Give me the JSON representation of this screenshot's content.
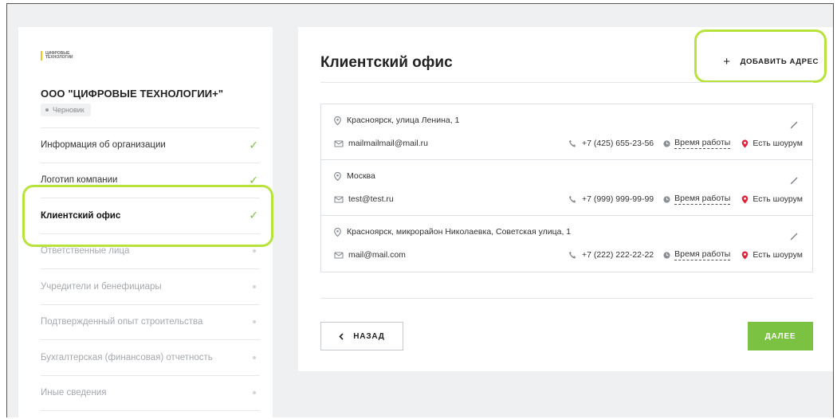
{
  "colors": {
    "accent": "#7cc242",
    "highlight": "#b8e23c",
    "pin_red": "#e0213a"
  },
  "sidebar": {
    "logo_text": "ЦИФРОВЫЕ ТЕХНОЛОГИИ",
    "org_name": "ООО \"ЦИФРОВЫЕ ТЕХНОЛОГИИ+\"",
    "status": "Черновик",
    "items": [
      {
        "label": "Информация об организации",
        "state": "done"
      },
      {
        "label": "Логотип компании",
        "state": "done"
      },
      {
        "label": "Клиентский офис",
        "state": "active"
      },
      {
        "label": "Ответственные лица",
        "state": "pending"
      },
      {
        "label": "Учредители и бенефициары",
        "state": "pending"
      },
      {
        "label": "Подтвержденный опыт строительства",
        "state": "pending"
      },
      {
        "label": "Бухгалтерская (финансовая) отчетность",
        "state": "pending"
      },
      {
        "label": "Иные сведения",
        "state": "pending"
      }
    ]
  },
  "main": {
    "title": "Клиентский офис",
    "add_button": "ДОБАВИТЬ АДРЕС",
    "addresses": [
      {
        "address": "Красноярск, улица Ленина, 1",
        "email": "mailmailmail@mail.ru",
        "phone": "+7 (425) 655-23-56",
        "hours": "Время работы",
        "showroom": "Есть шоурум"
      },
      {
        "address": "Москва",
        "email": "test@test.ru",
        "phone": "+7 (999) 999-99-99",
        "hours": "Время работы",
        "showroom": "Есть шоурум"
      },
      {
        "address": "Красноярск, микрорайон Николаевка, Советская улица, 1",
        "email": "mail@mail.com",
        "phone": "+7 (222) 222-22-22",
        "hours": "Время работы",
        "showroom": "Есть шоурум"
      }
    ],
    "back_button": "НАЗАД",
    "next_button": "ДАЛЕЕ"
  }
}
